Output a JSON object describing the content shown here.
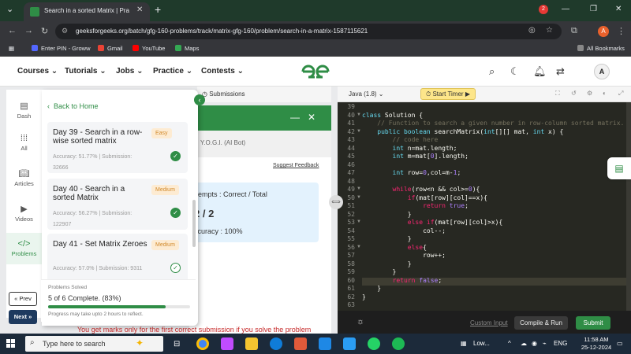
{
  "browser": {
    "tab_title": "Search in a sorted Matrix | Prac",
    "url": "geeksforgeeks.org/batch/gfg-160-problems/track/matrix-gfg-160/problem/search-in-a-matrix-1587115621",
    "profile_initial": "A",
    "bookmarks": [
      "Enter PIN - Groww",
      "Gmail",
      "YouTube",
      "Maps"
    ],
    "all_bookmarks": "All Bookmarks"
  },
  "header": {
    "nav": [
      "Courses",
      "Tutorials",
      "Jobs",
      "Practice",
      "Contests"
    ],
    "notif_count": "2",
    "avatar": "A"
  },
  "leftnav": {
    "items": [
      "Dash",
      "All",
      "Articles",
      "Videos",
      "Problems"
    ]
  },
  "track": {
    "back": "Back to Home",
    "cards": [
      {
        "title": "Day 39 - Search in a row-wise sorted matrix",
        "difficulty": "Easy",
        "stats": "Accuracy: 51.77% | Submission: 32666"
      },
      {
        "title": "Day 40 - Search in a sorted Matrix",
        "difficulty": "Medium",
        "stats": "Accuracy: 56.27% | Submission: 122907"
      },
      {
        "title": "Day 41 - Set Matrix Zeroes",
        "difficulty": "Medium",
        "stats": "Accuracy: 57.0% | Submission: 9311"
      }
    ],
    "solved_label": "Problems Solved",
    "solved_count": "5 of 6 Complete. (83%)",
    "solved_fraction": 0.83,
    "solved_note": "Progress may take upto 2 hours to reflect.",
    "prev": "« Prev",
    "next": "Next »"
  },
  "problem": {
    "submissions_tab": "Submissions",
    "ai_bot": "Y.O.G.I. (AI Bot)",
    "suggest": "Suggest Feedback",
    "attempts": "ttempts : Correct / Total",
    "score": "2 / 2",
    "accuracy": "ccuracy : 100%",
    "banner": "You get marks only for the first correct submission if you solve the problem"
  },
  "editor": {
    "language": "Java (1.8)",
    "timer": "Start Timer",
    "line_numbers": [
      "39",
      "40",
      "41",
      "42",
      "43",
      "44",
      "45",
      "46",
      "47",
      "48",
      "49",
      "50",
      "51",
      "52",
      "53",
      "54",
      "55",
      "56",
      "57",
      "58",
      "59",
      "60",
      "61",
      "62",
      "63"
    ],
    "custom_input": "Custom Input",
    "compile": "Compile & Run",
    "submit": "Submit"
  },
  "taskbar": {
    "search_placeholder": "Type here to search",
    "weather": "Low...",
    "lang": "ENG",
    "time": "11:58 AM",
    "date": "25-12-2024"
  },
  "colors": {
    "brand_green": "#2f8d46",
    "difficulty_badge": "#d18a2c"
  }
}
